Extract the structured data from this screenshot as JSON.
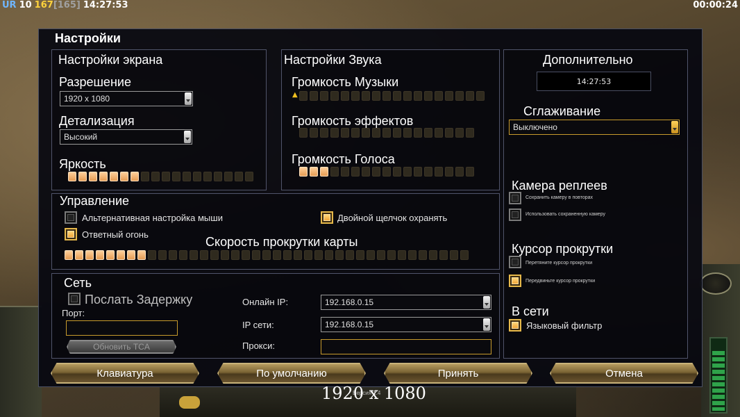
{
  "hud": {
    "stat_ur": "UR",
    "stat_10": "10",
    "stat_167": "167",
    "stat_165": "[165]",
    "time": "14:27:53",
    "timer": "00:00:24"
  },
  "dialog": {
    "title": "Настройки",
    "screen": {
      "title": "Настройки экрана",
      "resolution_label": "Разрешение",
      "resolution_value": "1920 x 1080",
      "detail_label": "Детализация",
      "detail_value": "Высокий",
      "brightness_label": "Яркость",
      "brightness_level": 0.4
    },
    "sound": {
      "title": "Настройки Звука",
      "music_label": "Громкость Музыки",
      "music_level": 0,
      "effects_label": "Громкость эффектов",
      "effects_level": 0,
      "voice_label": "Громкость Голоса",
      "voice_level": 0.2
    },
    "extra": {
      "title": "Дополнительно",
      "clock": "14:27:53",
      "aa_label": "Сглаживание",
      "aa_value": "Выключено",
      "replay_cam_label": "Камера реплеев",
      "replay_opt1": "Сохранить камеру в повторах",
      "replay_opt2": "Использовать сохраненную камеру",
      "scroll_cursor_label": "Курсор прокрутки",
      "scroll_opt1": "Перетяните курсор прокрутки",
      "scroll_opt2": "Передвиньте курсор прокрутки",
      "online_label": "В сети",
      "lang_filter": "Языковый фильтр"
    },
    "control": {
      "title": "Управление",
      "alt_mouse": "Альтернативная настройка мыши",
      "double_click": "Двойной щелчок охранять",
      "return_fire": "Ответный огонь",
      "scroll_speed_label": "Скорость прокрутки карты",
      "scroll_speed_level": 0.2
    },
    "network": {
      "title": "Сеть",
      "send_delay": "Послать Задержку",
      "port_label": "Порт:",
      "port_value": "",
      "update_tca": "Обновить TCA",
      "online_ip_label": "Онлайн IP:",
      "online_ip_value": "192.168.0.15",
      "lan_ip_label": "IP сети:",
      "lan_ip_value": "192.168.0.15",
      "proxy_label": "Прокси:",
      "proxy_value": ""
    },
    "buttons": {
      "keyboard": "Клавиатура",
      "defaults": "По умолчанию",
      "accept": "Принять",
      "cancel": "Отмена"
    }
  },
  "overlay": {
    "resolution": "1920 x 1080",
    "version": "Версия 1.4"
  },
  "colors": {
    "accent_gold": "#c89b2c",
    "slider_on": "#f0a860",
    "hud_ur": "#6fb6ff",
    "hud_10": "#ffffff",
    "hud_167": "#ffd23c",
    "hud_165": "#a0a0a0"
  }
}
